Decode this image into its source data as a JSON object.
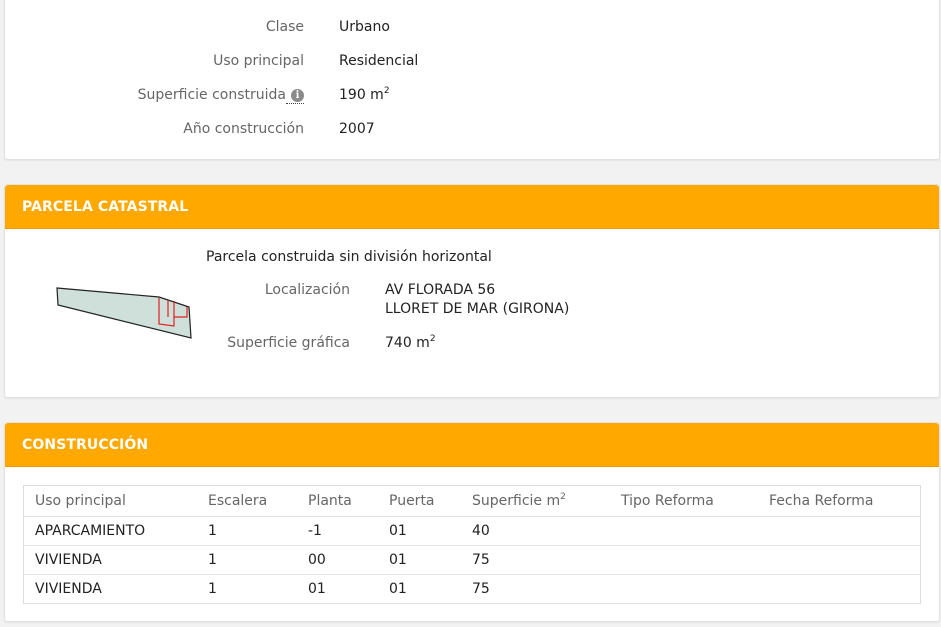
{
  "inmueble": {
    "rows": [
      {
        "label": "Clase",
        "value": "Urbano"
      },
      {
        "label": "Uso principal",
        "value": "Residencial"
      },
      {
        "label": "Superficie construida",
        "value": "190 m",
        "unit_sup": "2",
        "info_icon": "info-icon"
      },
      {
        "label": "Año construcción",
        "value": "2007"
      }
    ]
  },
  "parcela": {
    "header": "PARCELA CATASTRAL",
    "description": "Parcela construida sin división horizontal",
    "localizacion_label": "Localización",
    "localizacion_line1": "AV FLORADA 56",
    "localizacion_line2": "LLORET DE MAR (GIRONA)",
    "superficie_label": "Superficie gráfica",
    "superficie_value": "740 m",
    "superficie_sup": "2",
    "map_colors": {
      "fill": "#cfe0da",
      "stroke": "#222222",
      "building": "#e02020"
    }
  },
  "construccion": {
    "header": "CONSTRUCCIÓN",
    "columns": [
      "Uso principal",
      "Escalera",
      "Planta",
      "Puerta",
      "Superficie m",
      "Tipo Reforma",
      "Fecha Reforma"
    ],
    "superficie_sup": "2",
    "rows": [
      {
        "uso": "APARCAMIENTO",
        "escalera": "1",
        "planta": "-1",
        "puerta": "01",
        "superficie": "40",
        "tipo_reforma": "",
        "fecha_reforma": ""
      },
      {
        "uso": "VIVIENDA",
        "escalera": "1",
        "planta": "00",
        "puerta": "01",
        "superficie": "75",
        "tipo_reforma": "",
        "fecha_reforma": ""
      },
      {
        "uso": "VIVIENDA",
        "escalera": "1",
        "planta": "01",
        "puerta": "01",
        "superficie": "75",
        "tipo_reforma": "",
        "fecha_reforma": ""
      }
    ]
  },
  "colors": {
    "accent": "#ffa800",
    "label": "#666666",
    "text": "#222222"
  }
}
